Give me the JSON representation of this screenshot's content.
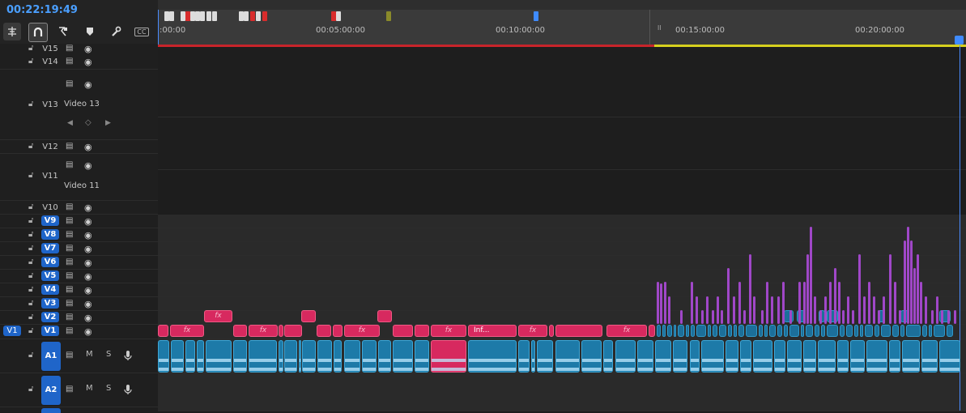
{
  "timecode": "00:22:19:49",
  "toolbar": {
    "icons": [
      "insert-edit-icon",
      "snap-magnet-icon",
      "linked-selection-icon",
      "add-marker-icon",
      "wrench-settings-icon",
      "captions-icon"
    ],
    "captions_label": "CC"
  },
  "ruler": {
    "labels": [
      ":00:00",
      "00:05:00:00",
      "00:10:00:00",
      "00:15:00:00",
      "00:20:00:00"
    ],
    "marker_colors": [
      "#e8e8e8",
      "#d82c2c",
      "#c8c8c8",
      "#d82c2c",
      "#8a8a2a",
      "#3f8bff"
    ],
    "render_bar_colors": {
      "rendered_preview": "#c8242b",
      "unrendered": "#d7d01e"
    }
  },
  "tracks": {
    "video": [
      {
        "id": "V15",
        "name": "",
        "targeted": false
      },
      {
        "id": "V14",
        "name": "",
        "targeted": false
      },
      {
        "id": "V13",
        "name": "Video 13",
        "targeted": false
      },
      {
        "id": "V12",
        "name": "",
        "targeted": false
      },
      {
        "id": "V11",
        "name": "Video 11",
        "targeted": false
      },
      {
        "id": "V10",
        "name": "",
        "targeted": false
      },
      {
        "id": "V9",
        "name": "",
        "targeted": true
      },
      {
        "id": "V8",
        "name": "",
        "targeted": true
      },
      {
        "id": "V7",
        "name": "",
        "targeted": true
      },
      {
        "id": "V6",
        "name": "",
        "targeted": true
      },
      {
        "id": "V5",
        "name": "",
        "targeted": true
      },
      {
        "id": "V4",
        "name": "",
        "targeted": true
      },
      {
        "id": "V3",
        "name": "",
        "targeted": true
      },
      {
        "id": "V2",
        "name": "",
        "targeted": true
      },
      {
        "id": "V1",
        "name": "",
        "targeted": true
      }
    ],
    "source_patch_v": "V1",
    "audio": [
      {
        "id": "A1",
        "mute": "M",
        "solo": "S"
      },
      {
        "id": "A2",
        "mute": "M",
        "solo": "S"
      }
    ]
  },
  "clips": {
    "fx_label": "fx",
    "text_clip_label": "Inf..."
  },
  "colors": {
    "video_clip": "#d7295f",
    "audio_clip": "#1d7aa8",
    "adjust_clip": "#a047c8",
    "timecode": "#4a9fff",
    "target_blue": "#1f65c9"
  }
}
